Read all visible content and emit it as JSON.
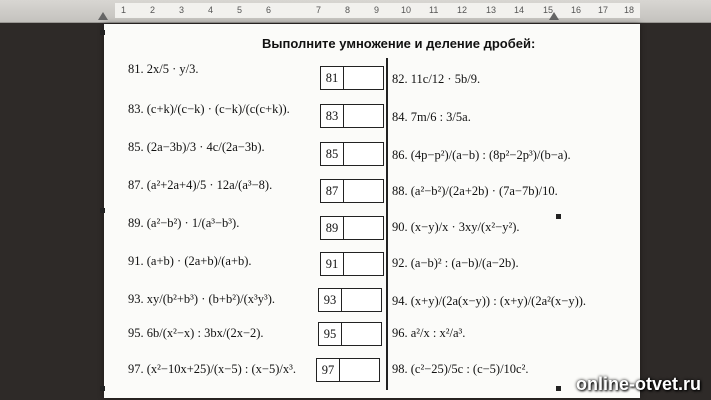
{
  "ruler": {
    "ticks": [
      "1",
      "2",
      "3",
      "4",
      "5",
      "6",
      "7",
      "8",
      "9",
      "10",
      "11",
      "12",
      "13",
      "14",
      "15",
      "16",
      "17",
      "18"
    ]
  },
  "worksheet": {
    "title": "Выполните умножение и деление дробей:",
    "left_problems": [
      {
        "num": "81.",
        "expr": "2x/5 · y/3."
      },
      {
        "num": "83.",
        "expr": "(c+k)/(c−k) · (c−k)/(c(c+k))."
      },
      {
        "num": "85.",
        "expr": "(2a−3b)/3 · 4c/(2a−3b)."
      },
      {
        "num": "87.",
        "expr": "(a²+2a+4)/5 · 12a/(a³−8)."
      },
      {
        "num": "89.",
        "expr": "(a²−b²) · 1/(a³−b³)."
      },
      {
        "num": "91.",
        "expr": "(a+b) · (2a+b)/(a+b)."
      },
      {
        "num": "93.",
        "expr": "xy/(b²+b³) · (b+b²)/(x³y³)."
      },
      {
        "num": "95.",
        "expr": "6b/(x²−x) : 3bx/(2x−2)."
      },
      {
        "num": "97.",
        "expr": "(x²−10x+25)/(x−5) : (x−5)/x³."
      }
    ],
    "right_problems": [
      {
        "num": "82.",
        "expr": "11c/12 · 5b/9."
      },
      {
        "num": "84.",
        "expr": "7m/6 : 3/5a."
      },
      {
        "num": "86.",
        "expr": "(4p−p²)/(a−b) : (8p²−2p³)/(b−a)."
      },
      {
        "num": "88.",
        "expr": "(a²−b²)/(2a+2b) · (7a−7b)/10."
      },
      {
        "num": "90.",
        "expr": "(x−y)/x · 3xy/(x²−y²)."
      },
      {
        "num": "92.",
        "expr": "(a−b)² : (a−b)/(a−2b)."
      },
      {
        "num": "94.",
        "expr": "(x+y)/(2a(x−y)) : (x+y)/(2a²(x−y))."
      },
      {
        "num": "96.",
        "expr": "a²/x : x²/a³."
      },
      {
        "num": "98.",
        "expr": "(c²−25)/5c : (c−5)/10c²."
      }
    ],
    "answer_boxes": [
      "81",
      "83",
      "85",
      "87",
      "89",
      "91",
      "93",
      "95",
      "97"
    ]
  },
  "watermark": "online-otvet.ru"
}
